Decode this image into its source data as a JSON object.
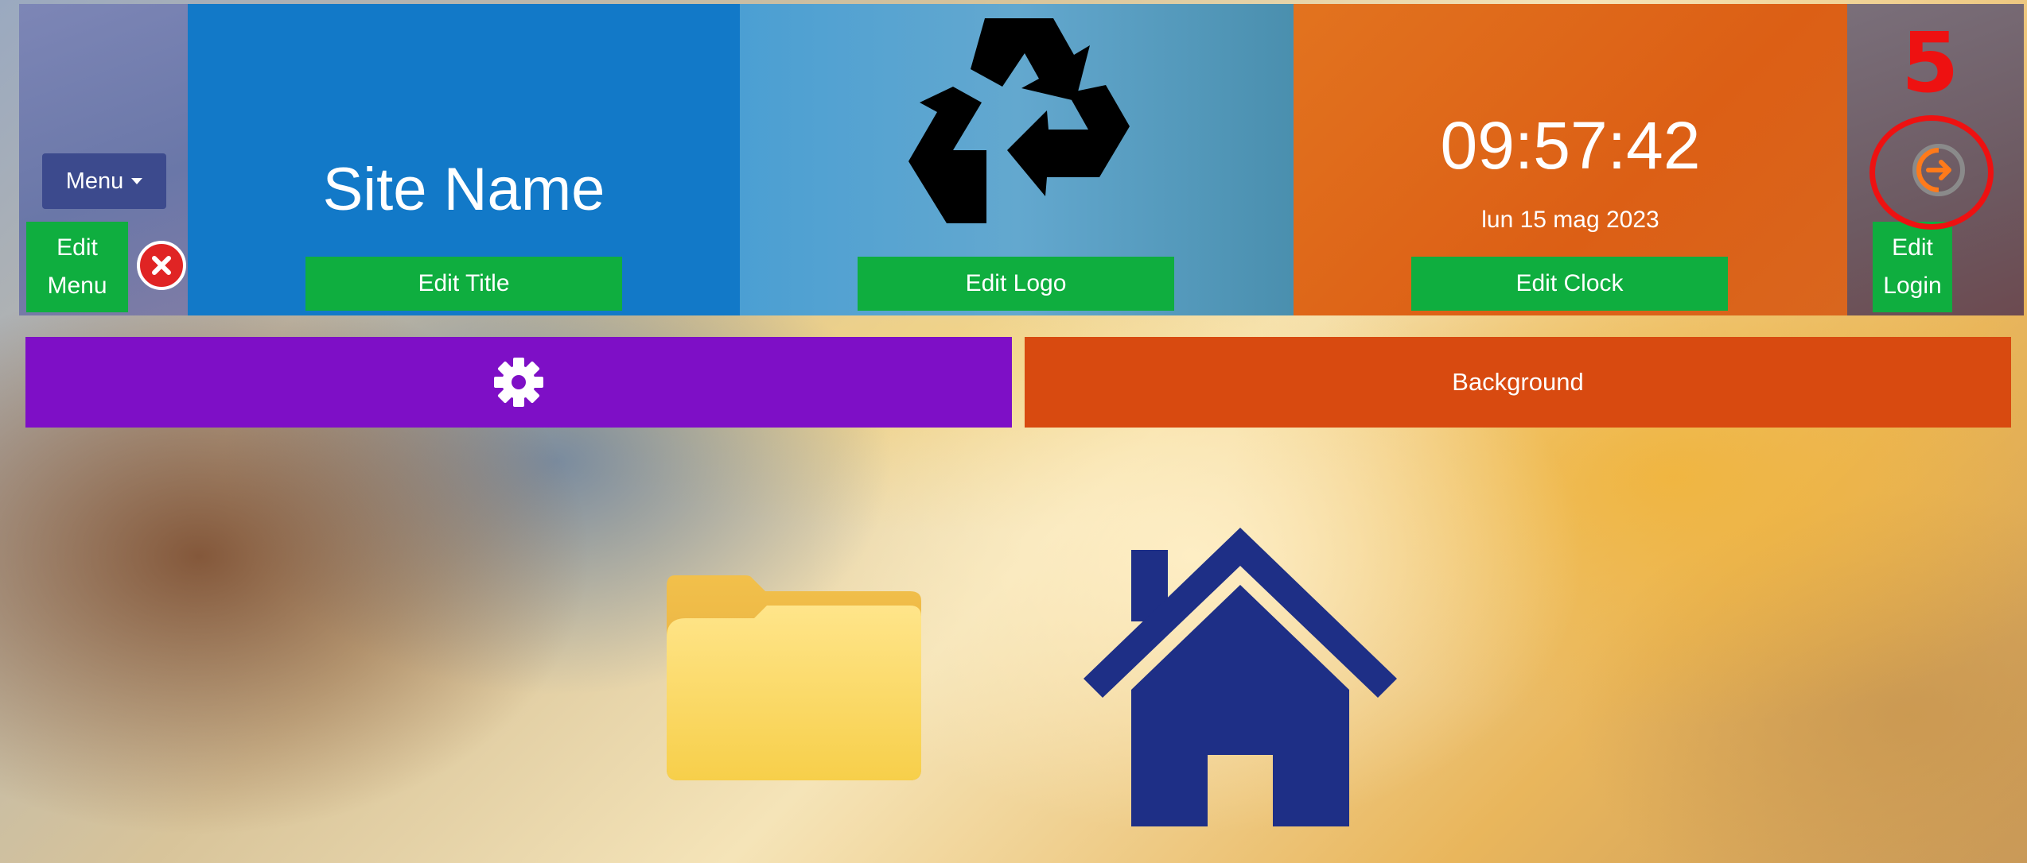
{
  "header": {
    "menu": {
      "dropdown_label": "Menu",
      "edit_label_line1": "Edit",
      "edit_label_line2": "Menu"
    },
    "title": {
      "site_name": "Site Name",
      "edit_label": "Edit Title"
    },
    "logo": {
      "icon": "recycle-icon",
      "edit_label": "Edit Logo"
    },
    "clock": {
      "time": "09:57:42",
      "date": "lun 15 mag 2023",
      "edit_label": "Edit Clock"
    },
    "login": {
      "icon": "login-icon",
      "edit_label_line1": "Edit",
      "edit_label_line2": "Login"
    }
  },
  "toolbar": {
    "settings_icon": "gear-icon",
    "background_label": "Background"
  },
  "desktop": {
    "icons": [
      "folder-icon",
      "home-icon"
    ]
  },
  "annotation": {
    "number": "5"
  },
  "colors": {
    "edit_button": "#0fae3f",
    "title_panel": "#1279c8",
    "clock_panel": "#dc5f15",
    "settings_bar": "#7e0fc6",
    "background_bar": "#d84a10",
    "annotation": "#ee1111",
    "home_icon": "#1e2f86"
  }
}
